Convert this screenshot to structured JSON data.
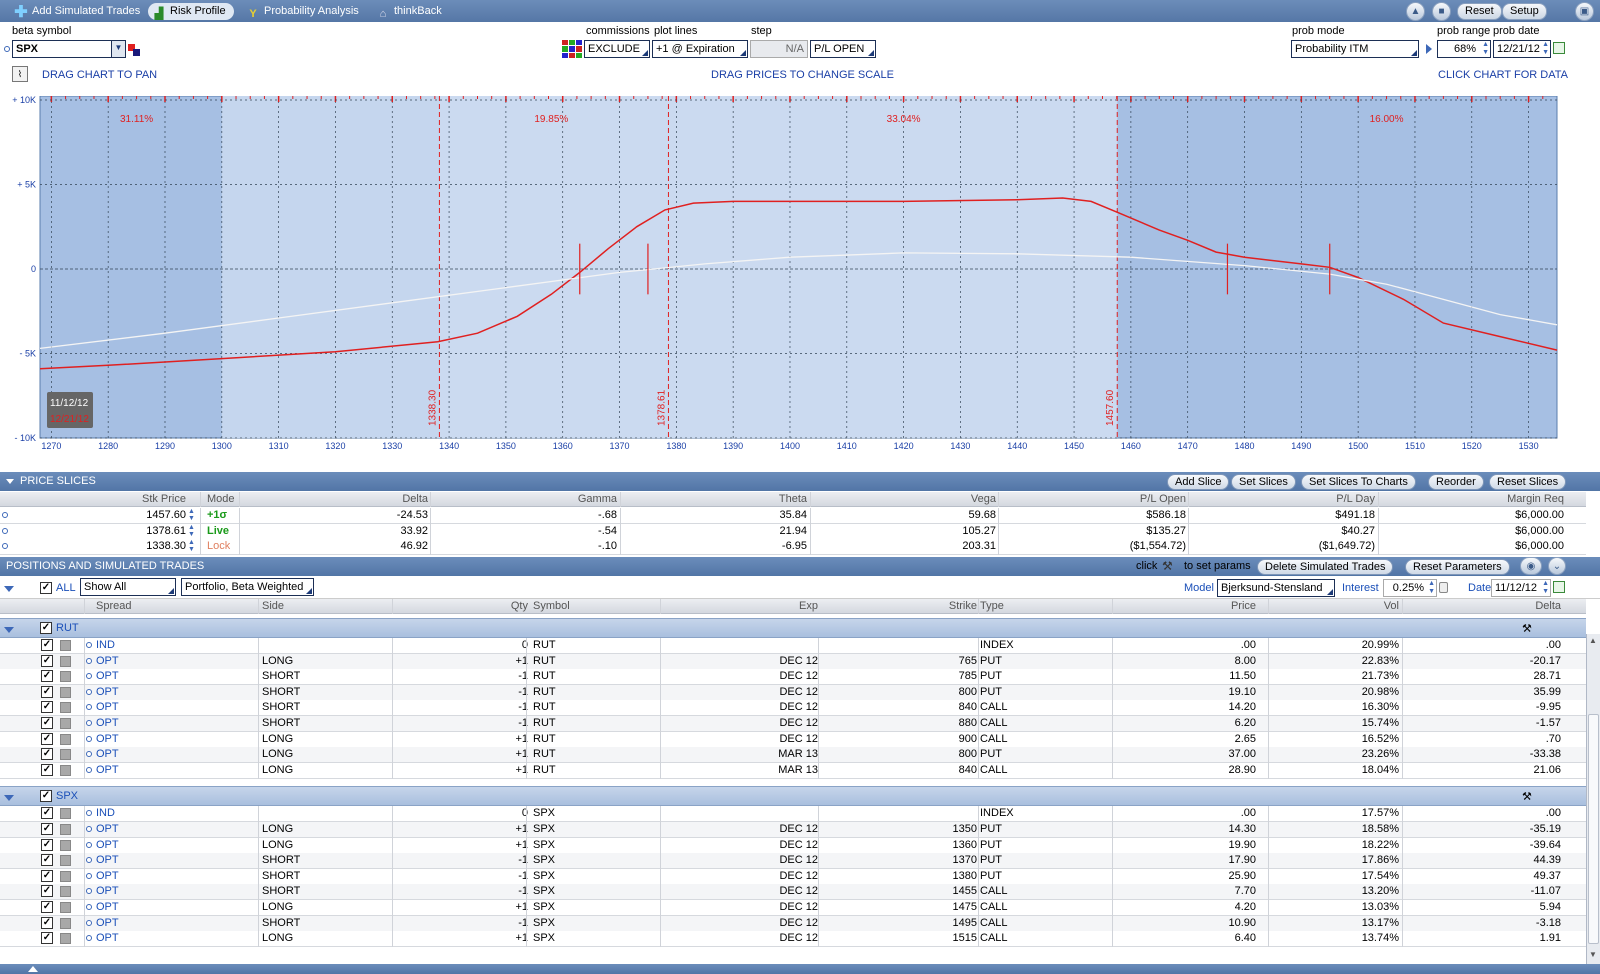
{
  "topbar": {
    "add_sim": "Add Simulated Trades",
    "risk_profile": "Risk Profile",
    "prob_analysis": "Probability Analysis",
    "thinkback": "thinkBack",
    "reset": "Reset",
    "setup": "Setup"
  },
  "controls": {
    "beta_symbol_label": "beta symbol",
    "beta_symbol": "SPX",
    "commissions_label": "commissions",
    "commissions": "EXCLUDE",
    "plot_lines_label": "plot lines",
    "plot_lines": "+1 @ Expiration",
    "step_label": "step",
    "step": "N/A",
    "pl_mode": "P/L OPEN",
    "prob_mode_label": "prob mode",
    "prob_mode": "Probability ITM",
    "prob_range_label": "prob range",
    "prob_range": "68%",
    "prob_date_label": "prob date",
    "prob_date": "12/21/12",
    "drag_pan": "DRAG CHART TO PAN",
    "drag_prices": "DRAG PRICES TO CHANGE SCALE",
    "click_chart": "CLICK CHART FOR DATA"
  },
  "chart_data": {
    "type": "line",
    "x_ticks": [
      "1270",
      "1280",
      "1290",
      "1300",
      "1310",
      "1320",
      "1330",
      "1340",
      "1350",
      "1360",
      "1370",
      "1380",
      "1390",
      "1400",
      "1410",
      "1420",
      "1430",
      "1440",
      "1450",
      "1460",
      "1470",
      "1480",
      "1490",
      "1500",
      "1510",
      "1520",
      "1530"
    ],
    "xlim": [
      1268,
      1535
    ],
    "y_ticks": [
      {
        "value": 10000,
        "label": "+ 10K"
      },
      {
        "value": 5000,
        "label": "+ 5K"
      },
      {
        "value": 0,
        "label": "0"
      },
      {
        "value": -5000,
        "label": "- 5K"
      },
      {
        "value": -10000,
        "label": "- 10K"
      }
    ],
    "ylim": [
      -10000,
      10000
    ],
    "grid": true,
    "prob_ranges": [
      {
        "from": 1268,
        "to": 1338.3,
        "label": "31.11%"
      },
      {
        "from": 1338.3,
        "to": 1378.61,
        "label": "19.85%"
      },
      {
        "from": 1378.61,
        "to": 1457.6,
        "label": "33.04%"
      },
      {
        "from": 1457.6,
        "to": 1535,
        "label": "16.00%"
      }
    ],
    "vertical_markers": [
      {
        "x": 1338.3,
        "label": "1338.30"
      },
      {
        "x": 1378.61,
        "label": "1378.61"
      },
      {
        "x": 1457.6,
        "label": "1457.60"
      }
    ],
    "date_labels": [
      "11/12/12",
      "12/21/12"
    ],
    "series": [
      {
        "points": [
          [
            1268,
            -5900
          ],
          [
            1280,
            -5700
          ],
          [
            1300,
            -5300
          ],
          [
            1320,
            -4900
          ],
          [
            1338,
            -4300
          ],
          [
            1345,
            -3800
          ],
          [
            1352,
            -2800
          ],
          [
            1358,
            -1500
          ],
          [
            1363,
            -200
          ],
          [
            1368,
            1200
          ],
          [
            1373,
            2500
          ],
          [
            1378,
            3500
          ],
          [
            1383,
            3900
          ],
          [
            1390,
            4000
          ],
          [
            1400,
            4000
          ],
          [
            1420,
            4000
          ],
          [
            1440,
            4100
          ],
          [
            1448,
            4200
          ],
          [
            1453,
            4000
          ],
          [
            1458,
            3300
          ],
          [
            1465,
            2300
          ],
          [
            1470,
            1700
          ],
          [
            1475,
            1000
          ],
          [
            1480,
            700
          ],
          [
            1490,
            300
          ],
          [
            1495,
            100
          ],
          [
            1500,
            -500
          ],
          [
            1508,
            -1800
          ],
          [
            1515,
            -3200
          ],
          [
            1525,
            -4000
          ],
          [
            1535,
            -4800
          ]
        ]
      },
      {
        "points": [
          [
            1268,
            -4700
          ],
          [
            1290,
            -3800
          ],
          [
            1310,
            -2900
          ],
          [
            1330,
            -2000
          ],
          [
            1350,
            -1100
          ],
          [
            1370,
            -200
          ],
          [
            1385,
            300
          ],
          [
            1400,
            700
          ],
          [
            1420,
            950
          ],
          [
            1440,
            900
          ],
          [
            1460,
            700
          ],
          [
            1480,
            200
          ],
          [
            1495,
            -300
          ],
          [
            1505,
            -900
          ],
          [
            1515,
            -1800
          ],
          [
            1525,
            -2700
          ],
          [
            1535,
            -3300
          ]
        ]
      }
    ]
  },
  "slices": {
    "title": "PRICE SLICES",
    "buttons": [
      "Add Slice",
      "Set Slices",
      "Set Slices To Charts",
      "Reorder",
      "Reset Slices"
    ],
    "columns": [
      "Stk Price",
      "Mode",
      "Delta",
      "Gamma",
      "Theta",
      "Vega",
      "P/L Open",
      "P/L Day",
      "Margin Req"
    ],
    "rows": [
      {
        "price": "1457.60",
        "mode": "+1σ",
        "delta": "-24.53",
        "gamma": "-.68",
        "theta": "35.84",
        "vega": "59.68",
        "pl_open": "$586.18",
        "pl_day": "$491.18",
        "margin": "$6,000.00"
      },
      {
        "price": "1378.61",
        "mode": "Live",
        "delta": "33.92",
        "gamma": "-.54",
        "theta": "21.94",
        "vega": "105.27",
        "pl_open": "$135.27",
        "pl_day": "$40.27",
        "margin": "$6,000.00"
      },
      {
        "price": "1338.30",
        "mode": "Lock",
        "delta": "46.92",
        "gamma": "-.10",
        "theta": "-6.95",
        "vega": "203.31",
        "pl_open": "($1,554.72)",
        "pl_day": "($1,649.72)",
        "margin": "$6,000.00"
      }
    ]
  },
  "positions": {
    "title": "POSITIONS AND SIMULATED TRADES",
    "click_hint": "click",
    "set_params_hint": "to set params",
    "delete_sim": "Delete Simulated Trades",
    "reset_params": "Reset Parameters",
    "all_label": "ALL",
    "show": "Show All",
    "portfolio": "Portfolio, Beta Weighted",
    "model_label": "Model",
    "model": "Bjerksund-Stensland",
    "interest_label": "Interest",
    "interest": "0.25%",
    "date_label": "Date",
    "date": "11/12/12",
    "columns": [
      "Spread",
      "Side",
      "Qty",
      "Symbol",
      "Exp",
      "Strike",
      "Type",
      "Price",
      "Vol",
      "Delta"
    ],
    "groups": [
      {
        "name": "RUT",
        "rows": [
          {
            "spread": "IND",
            "side": "",
            "qty": "0",
            "symbol": "RUT",
            "exp": "",
            "strike": "",
            "type": "INDEX",
            "price": ".00",
            "vol": "20.99%",
            "delta": ".00"
          },
          {
            "spread": "OPT",
            "side": "LONG",
            "qty": "+1",
            "symbol": "RUT",
            "exp": "DEC 12",
            "strike": "765",
            "type": "PUT",
            "price": "8.00",
            "vol": "22.83%",
            "delta": "-20.17"
          },
          {
            "spread": "OPT",
            "side": "SHORT",
            "qty": "-1",
            "symbol": "RUT",
            "exp": "DEC 12",
            "strike": "785",
            "type": "PUT",
            "price": "11.50",
            "vol": "21.73%",
            "delta": "28.71"
          },
          {
            "spread": "OPT",
            "side": "SHORT",
            "qty": "-1",
            "symbol": "RUT",
            "exp": "DEC 12",
            "strike": "800",
            "type": "PUT",
            "price": "19.10",
            "vol": "20.98%",
            "delta": "35.99"
          },
          {
            "spread": "OPT",
            "side": "SHORT",
            "qty": "-1",
            "symbol": "RUT",
            "exp": "DEC 12",
            "strike": "840",
            "type": "CALL",
            "price": "14.20",
            "vol": "16.30%",
            "delta": "-9.95"
          },
          {
            "spread": "OPT",
            "side": "SHORT",
            "qty": "-1",
            "symbol": "RUT",
            "exp": "DEC 12",
            "strike": "880",
            "type": "CALL",
            "price": "6.20",
            "vol": "15.74%",
            "delta": "-1.57"
          },
          {
            "spread": "OPT",
            "side": "LONG",
            "qty": "+1",
            "symbol": "RUT",
            "exp": "DEC 12",
            "strike": "900",
            "type": "CALL",
            "price": "2.65",
            "vol": "16.52%",
            "delta": ".70"
          },
          {
            "spread": "OPT",
            "side": "LONG",
            "qty": "+1",
            "symbol": "RUT",
            "exp": "MAR 13",
            "strike": "800",
            "type": "PUT",
            "price": "37.00",
            "vol": "23.26%",
            "delta": "-33.38"
          },
          {
            "spread": "OPT",
            "side": "LONG",
            "qty": "+1",
            "symbol": "RUT",
            "exp": "MAR 13",
            "strike": "840",
            "type": "CALL",
            "price": "28.90",
            "vol": "18.04%",
            "delta": "21.06"
          }
        ]
      },
      {
        "name": "SPX",
        "rows": [
          {
            "spread": "IND",
            "side": "",
            "qty": "0",
            "symbol": "SPX",
            "exp": "",
            "strike": "",
            "type": "INDEX",
            "price": ".00",
            "vol": "17.57%",
            "delta": ".00"
          },
          {
            "spread": "OPT",
            "side": "LONG",
            "qty": "+1",
            "symbol": "SPX",
            "exp": "DEC 12",
            "strike": "1350",
            "type": "PUT",
            "price": "14.30",
            "vol": "18.58%",
            "delta": "-35.19"
          },
          {
            "spread": "OPT",
            "side": "LONG",
            "qty": "+1",
            "symbol": "SPX",
            "exp": "DEC 12",
            "strike": "1360",
            "type": "PUT",
            "price": "19.90",
            "vol": "18.22%",
            "delta": "-39.64"
          },
          {
            "spread": "OPT",
            "side": "SHORT",
            "qty": "-1",
            "symbol": "SPX",
            "exp": "DEC 12",
            "strike": "1370",
            "type": "PUT",
            "price": "17.90",
            "vol": "17.86%",
            "delta": "44.39"
          },
          {
            "spread": "OPT",
            "side": "SHORT",
            "qty": "-1",
            "symbol": "SPX",
            "exp": "DEC 12",
            "strike": "1380",
            "type": "PUT",
            "price": "25.90",
            "vol": "17.54%",
            "delta": "49.37"
          },
          {
            "spread": "OPT",
            "side": "SHORT",
            "qty": "-1",
            "symbol": "SPX",
            "exp": "DEC 12",
            "strike": "1455",
            "type": "CALL",
            "price": "7.70",
            "vol": "13.20%",
            "delta": "-11.07"
          },
          {
            "spread": "OPT",
            "side": "LONG",
            "qty": "+1",
            "symbol": "SPX",
            "exp": "DEC 12",
            "strike": "1475",
            "type": "CALL",
            "price": "4.20",
            "vol": "13.03%",
            "delta": "5.94"
          },
          {
            "spread": "OPT",
            "side": "SHORT",
            "qty": "-1",
            "symbol": "SPX",
            "exp": "DEC 12",
            "strike": "1495",
            "type": "CALL",
            "price": "10.90",
            "vol": "13.17%",
            "delta": "-3.18"
          },
          {
            "spread": "OPT",
            "side": "LONG",
            "qty": "+1",
            "symbol": "SPX",
            "exp": "DEC 12",
            "strike": "1515",
            "type": "CALL",
            "price": "6.40",
            "vol": "13.74%",
            "delta": "1.91"
          }
        ]
      }
    ]
  },
  "colors": {
    "header_blue": "#5a7cae",
    "chart_bg": "#c5d6ee",
    "chart_outer": "#a6bfe3",
    "pl_line": "#e02020",
    "today_line": "#f4f4f4",
    "mode_live": "#1a9a1a",
    "mode_lock": "#e08060"
  }
}
